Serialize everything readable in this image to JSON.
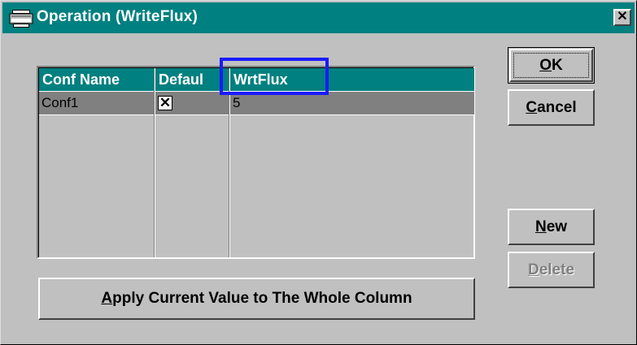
{
  "window": {
    "title": "Operation (WriteFlux)",
    "close_glyph": "✕"
  },
  "grid": {
    "columns": [
      "Conf Name",
      "Defaul",
      "WrtFlux"
    ],
    "rows": [
      {
        "conf_name": "Conf1",
        "default_checked": "✕",
        "wrtflux": "5"
      }
    ]
  },
  "buttons": {
    "ok": {
      "accel": "O",
      "rest": "K"
    },
    "cancel": {
      "accel": "C",
      "rest": "ancel"
    },
    "new": {
      "accel": "N",
      "rest": "ew"
    },
    "delete": {
      "accel": "D",
      "rest": "elete"
    },
    "apply": {
      "accel": "A",
      "rest": "pply Current Value to The Whole Column"
    }
  },
  "colors": {
    "titlebar": "#008080",
    "highlight_box": "#1a1aff",
    "face": "#c0c0c0"
  }
}
